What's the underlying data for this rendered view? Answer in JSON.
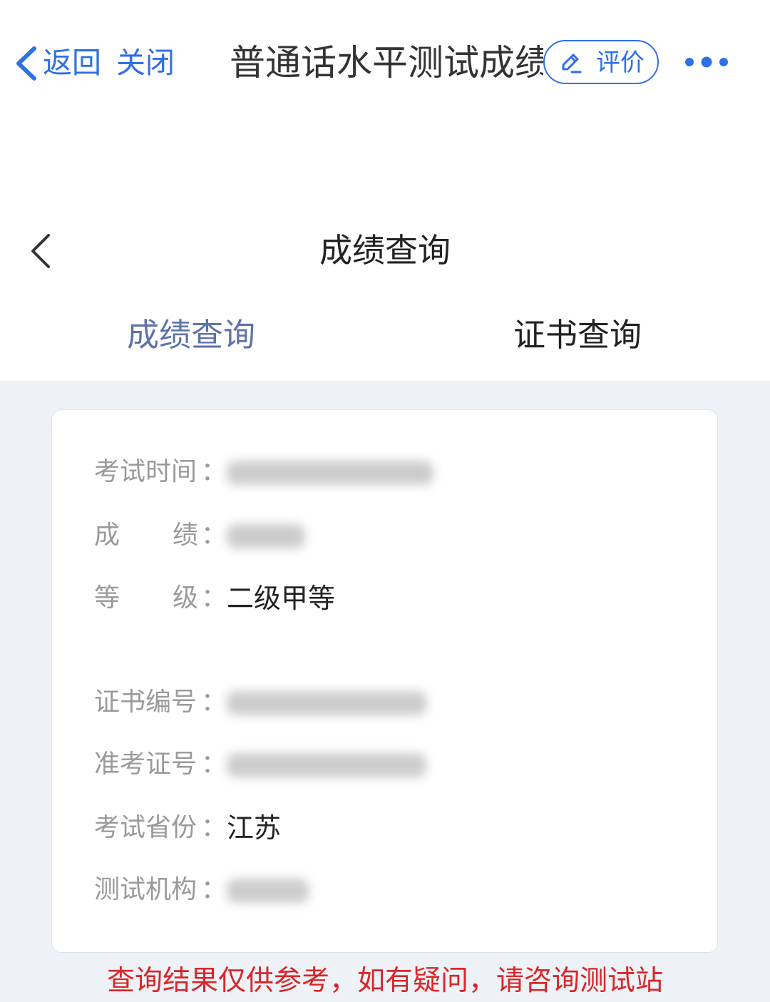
{
  "nav": {
    "back_label": "返回",
    "close_label": "关闭",
    "title": "普通话水平测试成绩",
    "rate_label": "评价",
    "accent_color": "#2f6fe8"
  },
  "page": {
    "title": "成绩查询"
  },
  "tabs": [
    {
      "label": "成绩查询",
      "active": true
    },
    {
      "label": "证书查询",
      "active": false
    }
  ],
  "result": {
    "exam_time_label": "考试时间",
    "score_label_a": "成",
    "score_label_b": "绩",
    "grade_label_a": "等",
    "grade_label_b": "级",
    "grade_value": "二级甲等",
    "cert_no_label": "证书编号",
    "admission_no_label": "准考证号",
    "province_label": "考试省份",
    "province_value": "江苏",
    "institution_label": "测试机构",
    "colon": "："
  },
  "notice": "查询结果仅供参考，如有疑问，请咨询测试站"
}
